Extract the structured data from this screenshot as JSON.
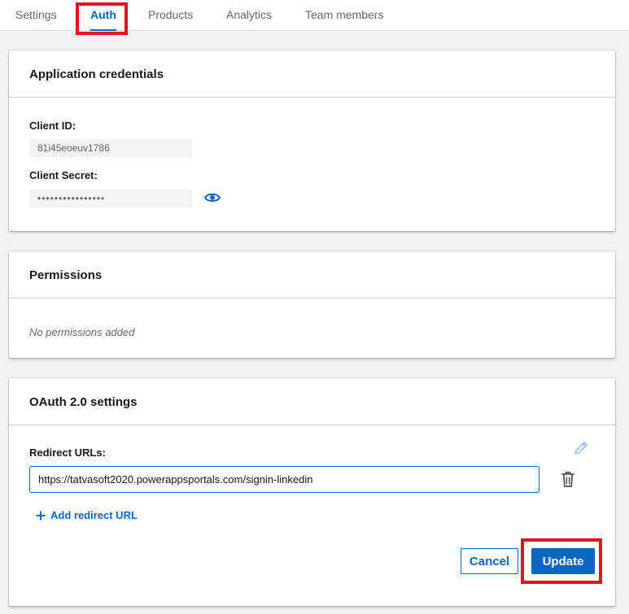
{
  "tabs": [
    {
      "label": "Settings"
    },
    {
      "label": "Auth"
    },
    {
      "label": "Products"
    },
    {
      "label": "Analytics"
    },
    {
      "label": "Team members"
    }
  ],
  "active_tab": "Auth",
  "credentials": {
    "title": "Application credentials",
    "client_id_label": "Client ID:",
    "client_id_value": "81i45eoeuv1786",
    "client_secret_label": "Client Secret:",
    "client_secret_value": "••••••••••••••••"
  },
  "permissions": {
    "title": "Permissions",
    "empty_text": "No permissions added"
  },
  "oauth": {
    "title": "OAuth 2.0 settings",
    "redirect_label": "Redirect URLs:",
    "redirect_url_value": "https://tatvasoft2020.powerappsportals.com/signin-linkedin",
    "add_redirect_label": "Add redirect URL",
    "cancel_label": "Cancel",
    "update_label": "Update"
  },
  "icons": {
    "show_secret": "eye-icon",
    "edit": "pencil-icon",
    "delete": "trash-icon",
    "add": "plus-icon"
  },
  "colors": {
    "accent": "#0a66c2",
    "highlight": "#e0161c"
  }
}
